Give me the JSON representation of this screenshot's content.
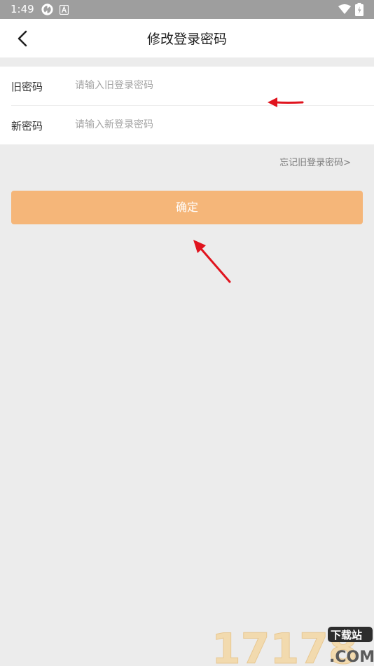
{
  "status_bar": {
    "time": "1:49",
    "icons": [
      "sync-icon",
      "a-notification-icon",
      "wifi-icon",
      "battery-icon"
    ]
  },
  "app_bar": {
    "back_icon": "chevron-left-icon",
    "title": "修改登录密码"
  },
  "form": {
    "old_password": {
      "label": "旧密码",
      "placeholder": "请输入旧登录密码",
      "value": ""
    },
    "new_password": {
      "label": "新密码",
      "placeholder": "请输入新登录密码",
      "value": ""
    }
  },
  "forgot_link": "忘记旧登录密码>",
  "confirm_button": "确定",
  "colors": {
    "background": "#ececec",
    "status_bar": "#9e9e9e",
    "button": "#f5b679",
    "annotation_arrow": "#e0141e"
  },
  "watermark": {
    "text": "17178",
    "badge": "下载站",
    "domain": ".COM"
  }
}
